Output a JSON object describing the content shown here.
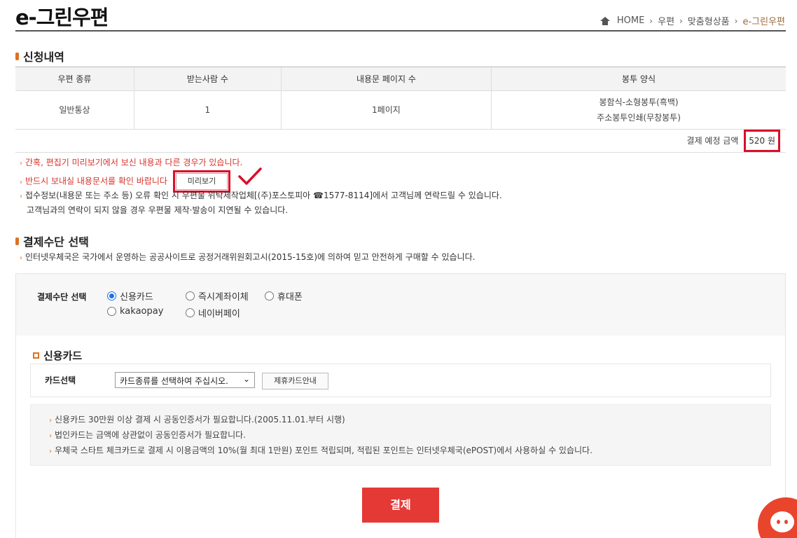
{
  "header": {
    "title": "e-그린우편",
    "breadcrumb": [
      "HOME",
      "우편",
      "맞춤형상품",
      "e-그린우편"
    ]
  },
  "application": {
    "section_title": "신청내역",
    "columns": [
      "우편 종류",
      "받는사람 수",
      "내용문 페이지 수",
      "봉투 양식"
    ],
    "row": {
      "mail_type": "일반통상",
      "recipients": "1",
      "pages": "1페이지",
      "envelope_line1": "봉함식-소형봉투(흑백)",
      "envelope_line2": "주소봉투인쇄(무창봉투)"
    },
    "total_label": "결제 예정 금액",
    "total_value": "520 원"
  },
  "notices": {
    "line1": "간혹, 편집기 미리보기에서 보신 내용과 다른 경우가 있습니다.",
    "line2": "반드시 보내실 내용문서를 확인 바랍니다",
    "preview_button": "미리보기",
    "line3": "접수정보(내용문 또는 주소 등) 오류 확인 시 우편물 위탁제작업체[(주)포스토피아 ☎1577-8114]에서 고객님께 연락드릴 수 있습니다.",
    "line4": "고객님과의 연락이 되지 않을 경우 우편물 제작·발송이 지연될 수 있습니다."
  },
  "payment": {
    "section_title": "결제수단 선택",
    "description": "인터넷우체국은 국가에서 운영하는 공공사이트로 공정거래위원회고시(2015-15호)에 의하여 믿고 안전하게 구매할 수 있습니다.",
    "label": "결제수단 선택",
    "options": [
      "신용카드",
      "즉시계좌이체",
      "휴대폰",
      "kakaopay",
      "네이버페이"
    ],
    "selected": "신용카드"
  },
  "card": {
    "title": "신용카드",
    "select_label": "카드선택",
    "select_value": "카드종류를 선택하여 주십시오.",
    "partner_button": "제휴카드안내",
    "info": [
      "신용카드 30만원 이상 결제 시 공동인증서가 필요합니다.(2005.11.01.부터 시행)",
      "법인카드는 금액에 상관없이 공동인증서가 필요합니다.",
      "우체국 스타트 체크카드로 결제 시 이용금액의 10%(월 최대 1만원) 포인트 적립되며, 적립된 포인트는 인터넷우체국(ePOST)에서 사용하실 수 있습니다."
    ],
    "pay_button": "결제"
  },
  "colors": {
    "accent": "#e07020",
    "alert": "#d8322a",
    "highlight_box": "#d8102a",
    "pay_button": "#e53935",
    "radio_selected": "#1a73e8"
  }
}
